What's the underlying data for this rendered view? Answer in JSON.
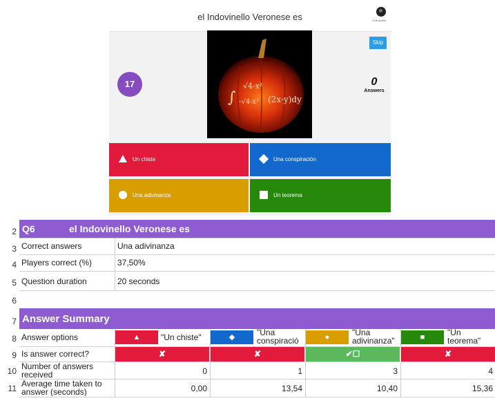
{
  "quiz": {
    "title": "el Indovinello Veronese es",
    "logo_caption": "Full screen",
    "skip_label": "Skip",
    "timer": "17",
    "answers_count": "0",
    "answers_label": "Answers",
    "options": [
      {
        "shape": "triangle",
        "label": "Un chiste",
        "color": "#e21b3c"
      },
      {
        "shape": "diamond",
        "label": "Una conspiración",
        "color": "#1368ce"
      },
      {
        "shape": "circle",
        "label": "Una adivinanza",
        "color": "#d89e00"
      },
      {
        "shape": "square",
        "label": "Un teorema",
        "color": "#26890c"
      }
    ]
  },
  "sheet": {
    "row_numbers": [
      "2",
      "3",
      "4",
      "5",
      "6",
      "7",
      "8",
      "9",
      "10",
      "11"
    ],
    "header": {
      "id": "Q6",
      "question": "el Indovinello Veronese es"
    },
    "info_rows": [
      {
        "label": "Correct answers",
        "value": "Una adivinanza"
      },
      {
        "label": "Players correct (%)",
        "value": "37,50%"
      },
      {
        "label": "Question duration",
        "value": "20 seconds"
      }
    ],
    "summary_title": "Answer Summary",
    "answer_options_label": "Answer options",
    "answer_options": [
      {
        "shape": "▲",
        "text": "\"Un chiste\""
      },
      {
        "shape": "◆",
        "text": "\"Una conspiració"
      },
      {
        "shape": "●",
        "text": "\"Una adivinanza\""
      },
      {
        "shape": "■",
        "text": "\"Un teorema\""
      }
    ],
    "is_correct_label": "Is answer correct?",
    "is_correct": [
      "✘",
      "✘",
      "✔☐",
      "✘"
    ],
    "num_answers_label": "Number of answers received",
    "num_answers": [
      "0",
      "1",
      "3",
      "4"
    ],
    "avg_time_label": "Average time taken to answer (seconds)",
    "avg_time": [
      "0,00",
      "13,54",
      "10,40",
      "15,36"
    ]
  }
}
